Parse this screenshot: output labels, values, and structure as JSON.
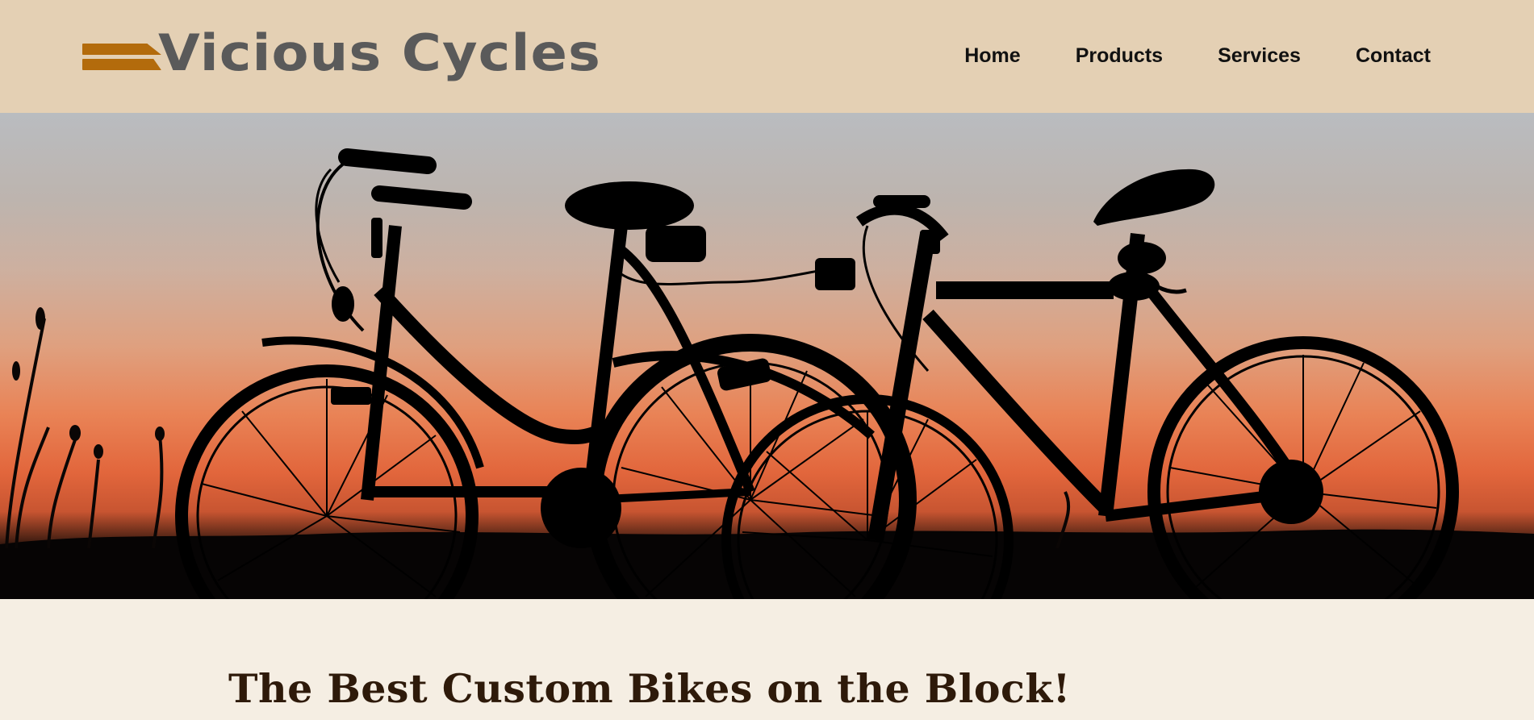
{
  "brand": {
    "name": "Vicious Cycles",
    "accent_color": "#b36b0c",
    "text_color": "#5a5a5a"
  },
  "nav": {
    "items": [
      {
        "label": "Home"
      },
      {
        "label": "Products"
      },
      {
        "label": "Services"
      },
      {
        "label": "Contact"
      }
    ]
  },
  "hero": {
    "image": "bicycles-silhouette-sunset"
  },
  "main": {
    "headline": "The Best Custom Bikes on the Block!"
  },
  "colors": {
    "header_bg": "#e4d0b4",
    "page_bg": "#f5eee3",
    "headline": "#2e1a0a"
  }
}
